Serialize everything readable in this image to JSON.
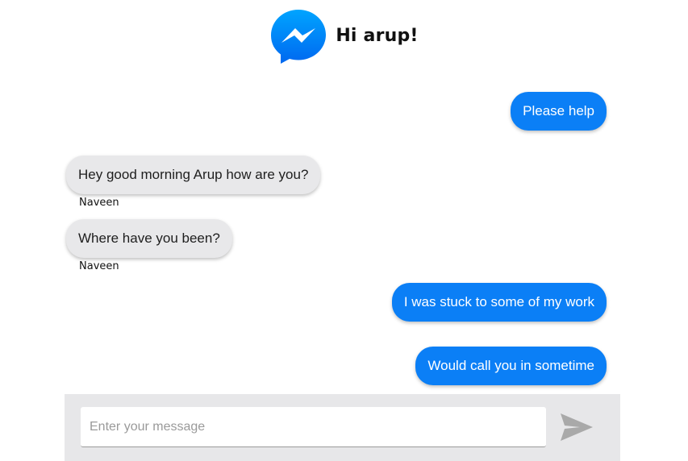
{
  "header": {
    "logo_icon": "messenger-logo-icon",
    "greeting": "Hi arup!"
  },
  "messages": [
    {
      "type": "sent",
      "text": "Please help"
    },
    {
      "type": "received",
      "text": "Hey good morning Arup how are you?",
      "sender": "Naveen"
    },
    {
      "type": "received",
      "text": "Where have you been?",
      "sender": "Naveen"
    },
    {
      "type": "sent",
      "text": "I was stuck to some of my work"
    },
    {
      "type": "sent",
      "text": "Would call you in sometime"
    }
  ],
  "composer": {
    "placeholder": "Enter your message",
    "value": "",
    "send_icon": "send-icon"
  },
  "colors": {
    "sent_bubble": "#0b7ff6",
    "received_bubble": "#e8e8ea",
    "input_bar": "#e7e7e9",
    "send_icon": "#a9a9a9"
  }
}
